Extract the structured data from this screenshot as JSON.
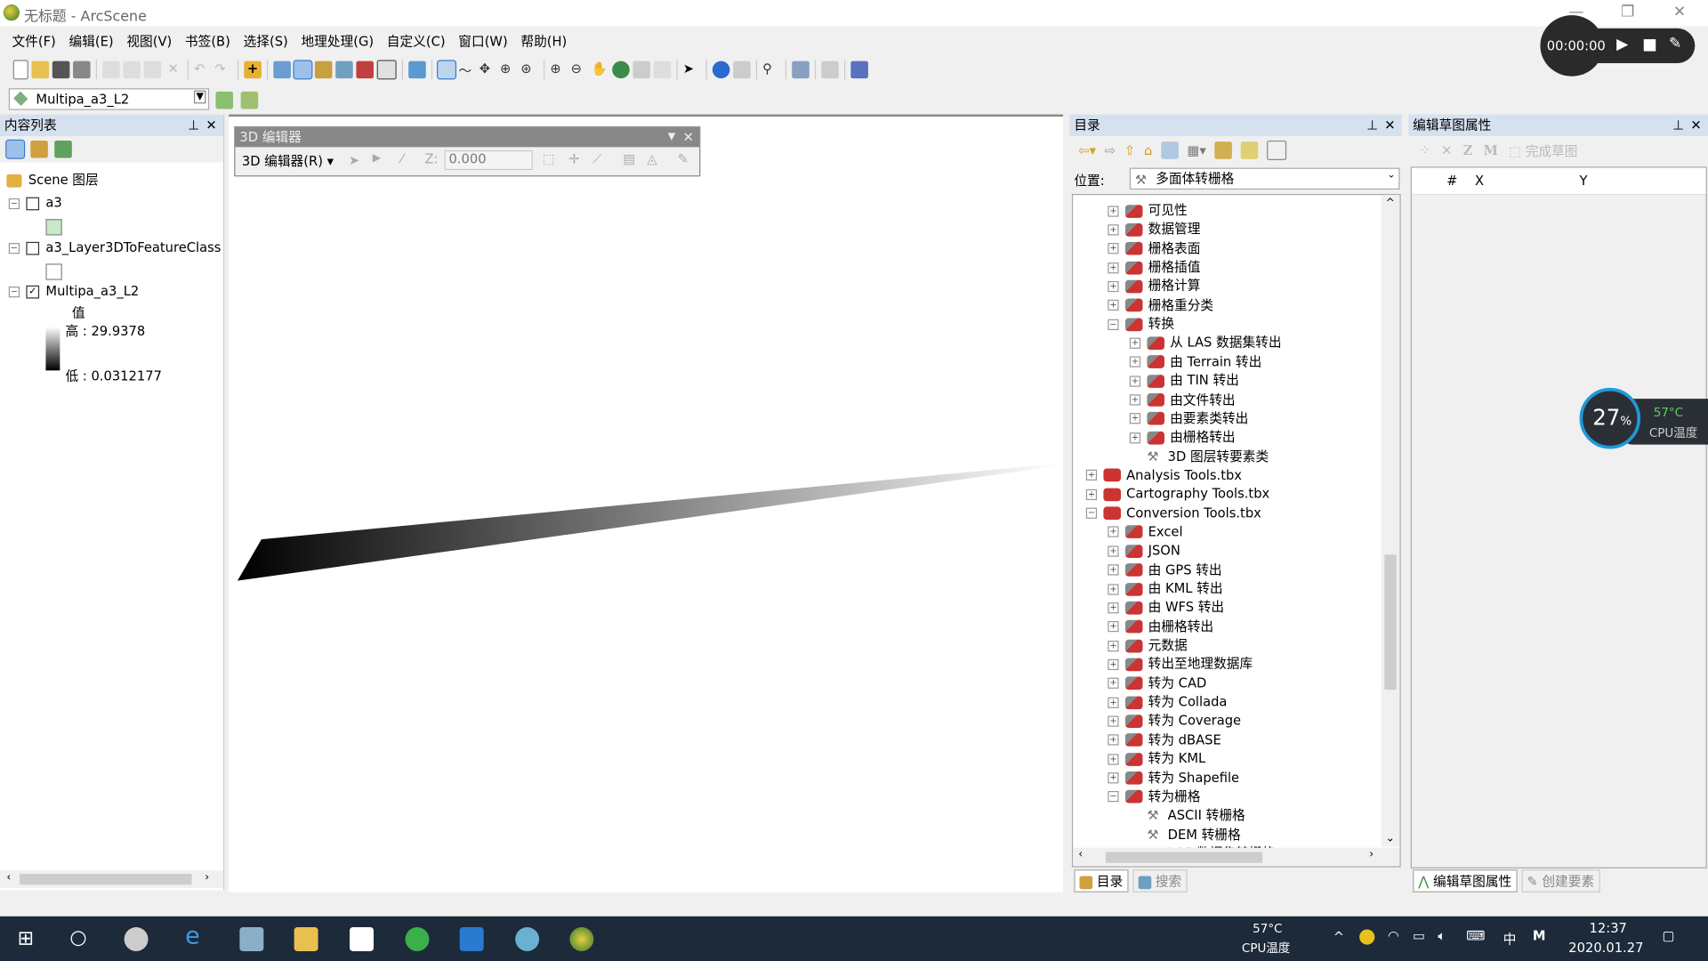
{
  "window": {
    "title": "无标题 - ArcScene"
  },
  "menu": [
    "文件(F)",
    "编辑(E)",
    "视图(V)",
    "书签(B)",
    "选择(S)",
    "地理处理(G)",
    "自定义(C)",
    "窗口(W)",
    "帮助(H)"
  ],
  "layer_select": {
    "value": "Multipa_a3_L2"
  },
  "toc": {
    "title": "内容列表",
    "root": "Scene 图层",
    "layers": [
      {
        "name": "a3",
        "checked": false
      },
      {
        "name": "a3_Layer3DToFeatureClass",
        "checked": false
      },
      {
        "name": "Multipa_a3_L2",
        "checked": true
      }
    ],
    "legend": {
      "field": "值",
      "high": "高 : 29.9378",
      "low": "低 : 0.0312177"
    }
  },
  "editor3d": {
    "title": "3D 编辑器",
    "menu": "3D 编辑器(R)",
    "z_value": "0.000",
    "z_label": "Z:"
  },
  "catalog": {
    "title": "目录",
    "location_label": "位置:",
    "location_value": "多面体转栅格",
    "tree": [
      {
        "label": "可见性",
        "level": 2,
        "type": "toolset",
        "exp": "+"
      },
      {
        "label": "数据管理",
        "level": 2,
        "type": "toolset",
        "exp": "+"
      },
      {
        "label": "栅格表面",
        "level": 2,
        "type": "toolset",
        "exp": "+"
      },
      {
        "label": "栅格插值",
        "level": 2,
        "type": "toolset",
        "exp": "+"
      },
      {
        "label": "栅格计算",
        "level": 2,
        "type": "toolset",
        "exp": "+"
      },
      {
        "label": "栅格重分类",
        "level": 2,
        "type": "toolset",
        "exp": "+"
      },
      {
        "label": "转换",
        "level": 2,
        "type": "toolset",
        "exp": "-"
      },
      {
        "label": "从 LAS 数据集转出",
        "level": 3,
        "type": "toolset",
        "exp": "+"
      },
      {
        "label": "由 Terrain 转出",
        "level": 3,
        "type": "toolset",
        "exp": "+"
      },
      {
        "label": "由 TIN 转出",
        "level": 3,
        "type": "toolset",
        "exp": "+"
      },
      {
        "label": "由文件转出",
        "level": 3,
        "type": "toolset",
        "exp": "+"
      },
      {
        "label": "由要素类转出",
        "level": 3,
        "type": "toolset",
        "exp": "+"
      },
      {
        "label": "由栅格转出",
        "level": 3,
        "type": "toolset",
        "exp": "+"
      },
      {
        "label": "3D 图层转要素类",
        "level": 3,
        "type": "tool",
        "exp": ""
      },
      {
        "label": "Analysis Tools.tbx",
        "level": 1,
        "type": "toolbox",
        "exp": "+"
      },
      {
        "label": "Cartography Tools.tbx",
        "level": 1,
        "type": "toolbox",
        "exp": "+"
      },
      {
        "label": "Conversion Tools.tbx",
        "level": 1,
        "type": "toolbox",
        "exp": "-"
      },
      {
        "label": "Excel",
        "level": 2,
        "type": "toolset",
        "exp": "+"
      },
      {
        "label": "JSON",
        "level": 2,
        "type": "toolset",
        "exp": "+"
      },
      {
        "label": "由 GPS 转出",
        "level": 2,
        "type": "toolset",
        "exp": "+"
      },
      {
        "label": "由 KML 转出",
        "level": 2,
        "type": "toolset",
        "exp": "+"
      },
      {
        "label": "由 WFS 转出",
        "level": 2,
        "type": "toolset",
        "exp": "+"
      },
      {
        "label": "由栅格转出",
        "level": 2,
        "type": "toolset",
        "exp": "+"
      },
      {
        "label": "元数据",
        "level": 2,
        "type": "toolset",
        "exp": "+"
      },
      {
        "label": "转出至地理数据库",
        "level": 2,
        "type": "toolset",
        "exp": "+"
      },
      {
        "label": "转为 CAD",
        "level": 2,
        "type": "toolset",
        "exp": "+"
      },
      {
        "label": "转为 Collada",
        "level": 2,
        "type": "toolset",
        "exp": "+"
      },
      {
        "label": "转为 Coverage",
        "level": 2,
        "type": "toolset",
        "exp": "+"
      },
      {
        "label": "转为 dBASE",
        "level": 2,
        "type": "toolset",
        "exp": "+"
      },
      {
        "label": "转为 KML",
        "level": 2,
        "type": "toolset",
        "exp": "+"
      },
      {
        "label": "转为 Shapefile",
        "level": 2,
        "type": "toolset",
        "exp": "+"
      },
      {
        "label": "转为栅格",
        "level": 2,
        "type": "toolset",
        "exp": "-"
      },
      {
        "label": "ASCII 转栅格",
        "level": 3,
        "type": "tool",
        "exp": ""
      },
      {
        "label": "DEM 转栅格",
        "level": 3,
        "type": "tool",
        "exp": ""
      },
      {
        "label": "LAS 数据集转栅格",
        "level": 3,
        "type": "tool",
        "exp": ""
      }
    ],
    "tabs": [
      "目录",
      "搜索"
    ]
  },
  "sketch": {
    "title": "编辑草图属性",
    "finish": "完成草图",
    "columns": [
      "#",
      "X",
      "Y"
    ],
    "tabs": [
      "编辑草图属性",
      "创建要素"
    ]
  },
  "recorder": {
    "time": "00:00:00"
  },
  "cpu_widget": {
    "percent": "27",
    "unit": "%",
    "temp": "57°C",
    "label": "CPU温度"
  },
  "taskbar": {
    "temp": "57°C",
    "temp_label": "CPU温度",
    "ime": "中",
    "time": "12:37",
    "date": "2020.01.27"
  }
}
